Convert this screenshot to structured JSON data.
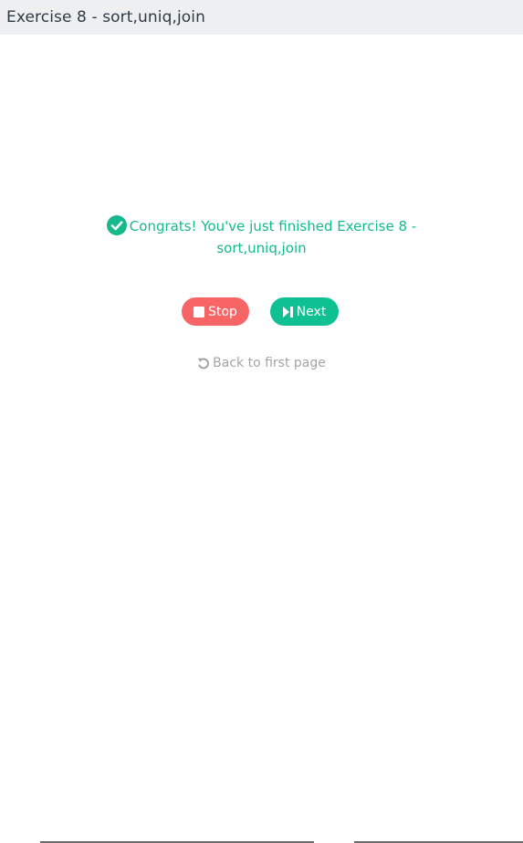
{
  "header": {
    "title": "Exercise 8 - sort,uniq,join"
  },
  "message": {
    "text": "Congrats! You've just finished Exercise 8 - sort,uniq,join",
    "icon": "check-circle-icon",
    "color": "#16b98c"
  },
  "buttons": {
    "stop": {
      "label": "Stop",
      "icon": "stop-icon",
      "color": "#f86566"
    },
    "next": {
      "label": "Next",
      "icon": "step-forward-icon",
      "color": "#0fc093"
    }
  },
  "back_link": {
    "label": "Back to first page",
    "icon": "undo-icon"
  }
}
